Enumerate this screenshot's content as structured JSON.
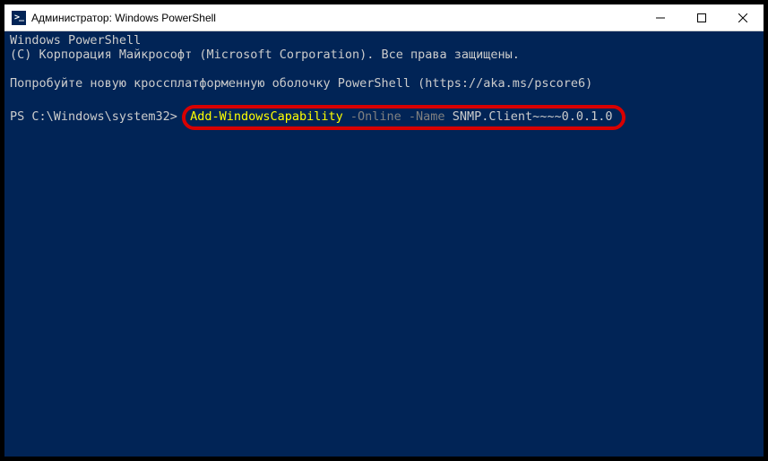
{
  "titlebar": {
    "title": "Администратор: Windows PowerShell"
  },
  "terminal": {
    "line1": "Windows PowerShell",
    "line2": "(C) Корпорация Майкрософт (Microsoft Corporation). Все права защищены.",
    "line3": "Попробуйте новую кроссплатформенную оболочку PowerShell (https://aka.ms/pscore6)",
    "prompt": "PS C:\\Windows\\system32> ",
    "command": {
      "cmdlet": "Add-WindowsCapability",
      "param1": " -Online",
      "param2": " -Name",
      "value": " SNMP.Client~~~~0.0.1.0"
    }
  }
}
